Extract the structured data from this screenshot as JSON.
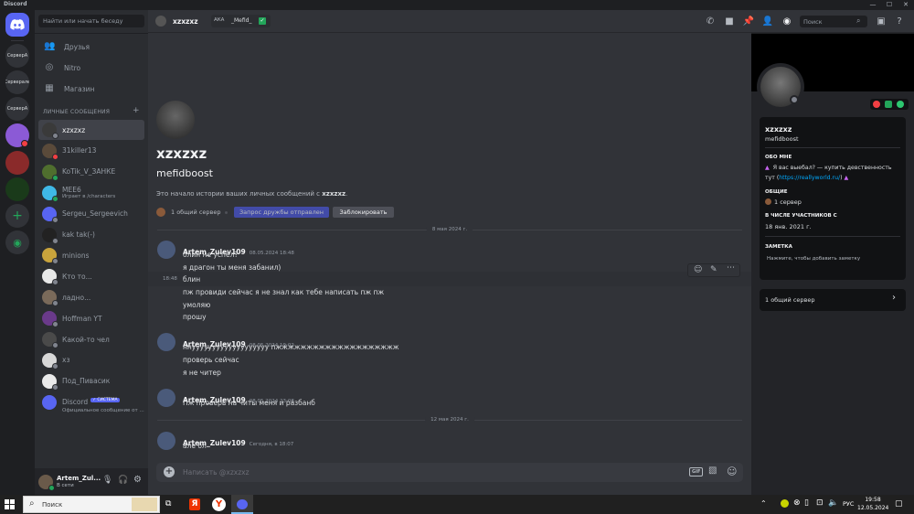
{
  "app": {
    "title": "Discord"
  },
  "window_controls": [
    "—",
    "☐",
    "✕"
  ],
  "servers": [
    {
      "label": "СерверА"
    },
    {
      "label": "Серверале"
    },
    {
      "label": "СерверА"
    }
  ],
  "dm_sidebar": {
    "search_placeholder": "Найти или начать беседу",
    "nav": [
      {
        "label": "Друзья",
        "icon": "friends-icon"
      },
      {
        "label": "Nitro",
        "icon": "nitro-icon"
      },
      {
        "label": "Магазин",
        "icon": "shop-icon"
      }
    ],
    "section_header": "ЛИЧНЫЕ СООБЩЕНИЯ",
    "dms": [
      {
        "name": "xzxzxz",
        "sub": "",
        "color": "#3a3a3a",
        "status": "#80848e"
      },
      {
        "name": "31killer13",
        "sub": "",
        "color": "#5a4a3a",
        "status": "#f23f43"
      },
      {
        "name": "KoTik_V_ЗАНКЕ",
        "sub": "",
        "color": "#4f6e2e",
        "status": "#23a55a"
      },
      {
        "name": "MEE6",
        "sub": "Играет в /characters",
        "color": "#3fb8e6",
        "status": "#23a55a"
      },
      {
        "name": "Sergeu_Sergeevich",
        "sub": "",
        "color": "#5865f2",
        "status": "#80848e"
      },
      {
        "name": "kak tak(-)",
        "sub": "",
        "color": "#222",
        "status": "#80848e"
      },
      {
        "name": "minions",
        "sub": "",
        "color": "#c9a43c",
        "status": "#80848e"
      },
      {
        "name": "Кто то...",
        "sub": "",
        "color": "#e8e8e8",
        "status": "#80848e"
      },
      {
        "name": "ладно...",
        "sub": "",
        "color": "#7a6a5a",
        "status": "#80848e"
      },
      {
        "name": "Hoffman YT",
        "sub": "",
        "color": "#6a3a8a",
        "status": "#80848e"
      },
      {
        "name": "Какой-то чел",
        "sub": "",
        "color": "#4a4a4a",
        "status": "#80848e"
      },
      {
        "name": "хз",
        "sub": "",
        "color": "#d8d8d8",
        "status": "#80848e"
      },
      {
        "name": "Под_Пивасик",
        "sub": "",
        "color": "#eaeaea",
        "status": "#80848e"
      },
      {
        "name": "Discord",
        "sub": "Официальное сообщение от ...",
        "badge": "✓ СИСТЕМА",
        "color": "#5865f2",
        "status": ""
      }
    ]
  },
  "user_panel": {
    "name": "Artem_Zul...",
    "status": "В сети"
  },
  "chat_header": {
    "name": "xzxzxz",
    "aka_label": "АКА",
    "aka_value": "_Mefid_",
    "search_placeholder": "Поиск"
  },
  "intro": {
    "display_name": "xzxzxz",
    "username": "mefidboost",
    "text_before": "Это начало истории ваших личных сообщений с",
    "text_user": "xzxzxz",
    "text_after": ".",
    "mutual_servers": "1 общий сервер",
    "friend_button": "Запрос дружбы отправлен",
    "block_button": "Заблокировать"
  },
  "dates": {
    "first": "8 мая 2024 г.",
    "second": "12 мая 2024 г."
  },
  "messages": [
    {
      "author": "Artem_Zulev109",
      "time": "08.05.2024 18:48",
      "lines": [
        "блин не успел?",
        "я драгон ты меня забанил)"
      ]
    },
    {
      "hover_time": "18:48",
      "lines": [
        "блин",
        "пж провиди сейчас я не знал как тебе написать пж пж",
        "умоляю",
        "прошу"
      ]
    },
    {
      "author": "Artem_Zulev109",
      "time": "08.05.2024 19:02",
      "lines": [
        "ннууууууууууууууууууу пжжжжжжжжжжжжжжжжжжжж",
        "проверь сейчас",
        "я не читер"
      ]
    },
    {
      "author": "Artem_Zulev109",
      "time": "08.05.2024 23:08",
      "lines": [
        "Пж проверь на читы меня и разбанб"
      ]
    },
    {
      "author": "Artem_Zulev109",
      "time": "Сегодня, в 18:07",
      "lines": [
        "але бл"
      ]
    }
  ],
  "composer": {
    "placeholder": "Написать @xzxzxz",
    "gif": "GIF"
  },
  "profile": {
    "display_name": "xzxzxz",
    "username": "mefidboost",
    "about_label": "ОБО МНЕ",
    "about_text_1": "Я  вас выебал? — купить девственность",
    "about_text_2": "тут",
    "about_link": "https://reallyworld.ru/",
    "common_label": "ОБЩИЕ",
    "common_value": "1 сервер",
    "member_label": "В ЧИСЛЕ УЧАСТНИКОВ С",
    "member_value": "18 янв. 2021 г.",
    "note_label": "ЗАМЕТКА",
    "note_placeholder": "Нажмите, чтобы добавить заметку",
    "mutual_servers": "1 общий сервер"
  },
  "taskbar": {
    "search_placeholder": "Поиск",
    "lang": "РУС",
    "time": "19:58",
    "date": "12.05.2024"
  },
  "colors": {
    "accent": "#5865f2",
    "online": "#23a55a",
    "dnd": "#f23f43",
    "link": "#00a8fc"
  }
}
